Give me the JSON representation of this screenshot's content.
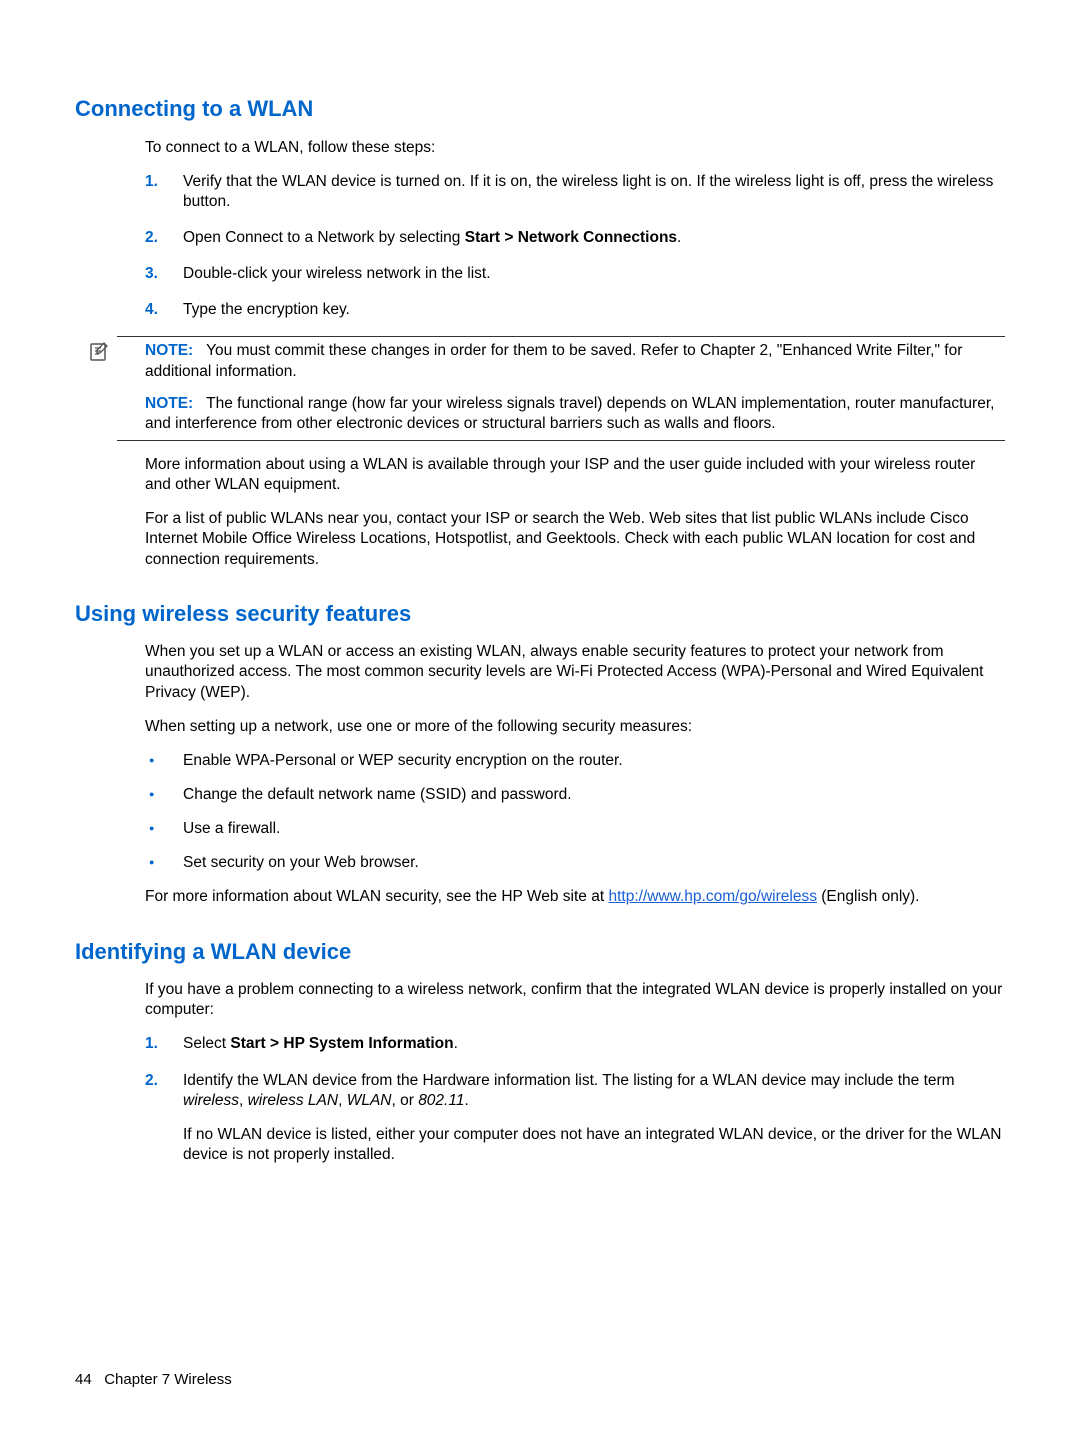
{
  "section1": {
    "heading": "Connecting to a WLAN",
    "intro": "To connect to a WLAN, follow these steps:",
    "steps": [
      "Verify that the WLAN device is turned on. If it is on, the wireless light is on. If the wireless light is off, press the wireless button.",
      "Open Connect to a Network by selecting ",
      "Double-click your wireless network in the list.",
      "Type the encryption key."
    ],
    "step2_bold": "Start > Network Connections",
    "step2_suffix": ".",
    "note_label": "NOTE:",
    "note1": "You must commit these changes in order for them to be saved. Refer to Chapter 2, \"Enhanced Write Filter,\" for additional information.",
    "note2": "The functional range (how far your wireless signals travel) depends on WLAN implementation, router manufacturer, and interference from other electronic devices or structural barriers such as walls and floors.",
    "para1": "More information about using a WLAN is available through your ISP and the user guide included with your wireless router and other WLAN equipment.",
    "para2": "For a list of public WLANs near you, contact your ISP or search the Web. Web sites that list public WLANs include Cisco Internet Mobile Office Wireless Locations, Hotspotlist, and Geektools. Check with each public WLAN location for cost and connection requirements."
  },
  "section2": {
    "heading": "Using wireless security features",
    "para1": "When you set up a WLAN or access an existing WLAN, always enable security features to protect your network from unauthorized access. The most common security levels are Wi-Fi Protected Access (WPA)-Personal and Wired Equivalent Privacy (WEP).",
    "para2": "When setting up a network, use one or more of the following security measures:",
    "bullets": [
      "Enable WPA-Personal or WEP security encryption on the router.",
      "Change the default network name (SSID) and password.",
      "Use a firewall.",
      "Set security on your Web browser."
    ],
    "para3_prefix": "For more information about WLAN security, see the HP Web site at ",
    "para3_link": "http://www.hp.com/go/wireless",
    "para3_suffix": " (English only)."
  },
  "section3": {
    "heading": "Identifying a WLAN device",
    "para1": "If you have a problem connecting to a wireless network, confirm that the integrated WLAN device is properly installed on your computer:",
    "step1_prefix": "Select ",
    "step1_bold": "Start > HP System Information",
    "step1_suffix": ".",
    "step2_text": "Identify the WLAN device from the Hardware information list. The listing for a WLAN device may include the term ",
    "step2_italic1": "wireless",
    "step2_italic2": "wireless LAN",
    "step2_italic3": "WLAN",
    "step2_or": ", or ",
    "step2_italic4": "802.11",
    "step2_period": ".",
    "step2_sub": "If no WLAN device is listed, either your computer does not have an integrated WLAN device, or the driver for the WLAN device is not properly installed."
  },
  "footer": {
    "page": "44",
    "chapter": "Chapter 7   Wireless"
  }
}
